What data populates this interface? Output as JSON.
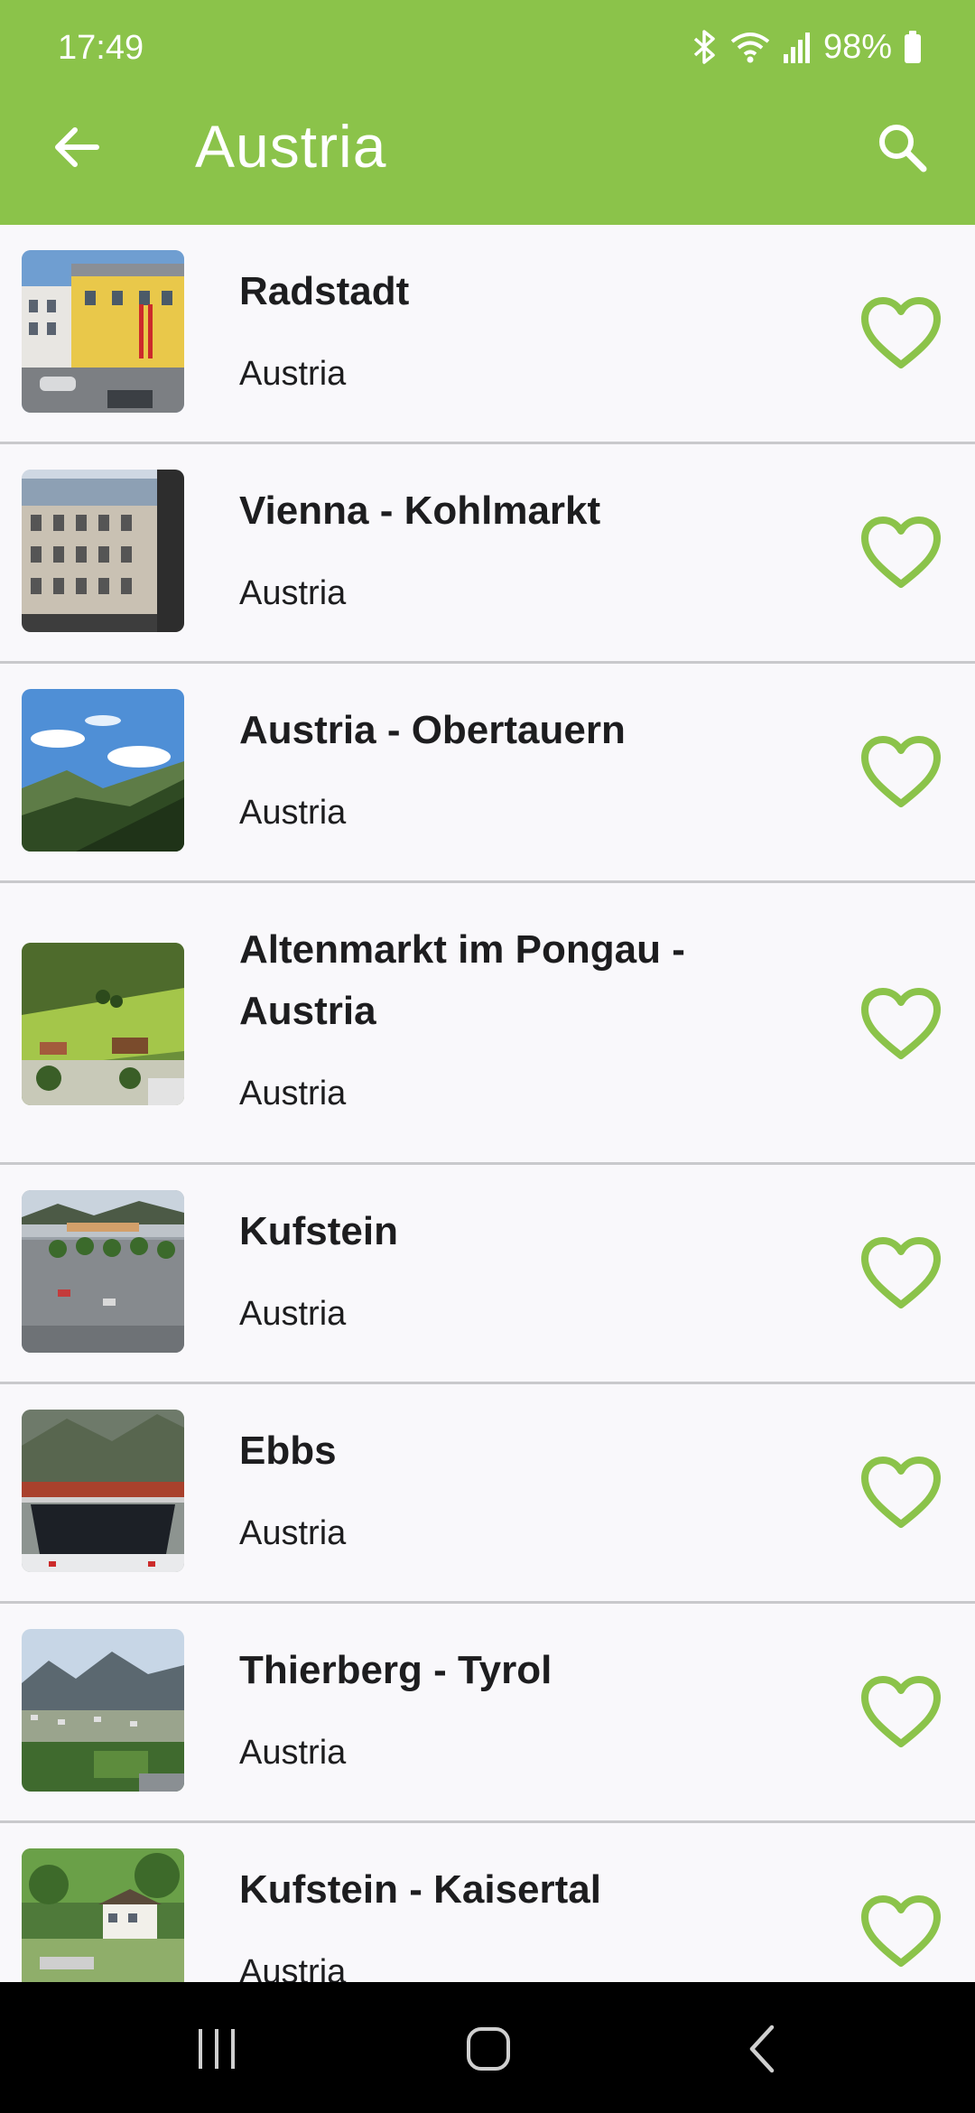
{
  "status_bar": {
    "time": "17:49",
    "battery": "98%",
    "icons": [
      "bluetooth-icon",
      "wifi-icon",
      "signal-icon",
      "battery-icon"
    ]
  },
  "app_bar": {
    "title": "Austria",
    "back_icon": "arrow-left-icon",
    "search_icon": "search-icon",
    "background_color": "#8bc34a"
  },
  "accent_color": "#8bc34a",
  "webcams": [
    {
      "title": "Radstadt",
      "country": "Austria",
      "favorite": false
    },
    {
      "title": "Vienna - Kohlmarkt",
      "country": "Austria",
      "favorite": false
    },
    {
      "title": "Austria - Obertauern",
      "country": "Austria",
      "favorite": false
    },
    {
      "title": "Altenmarkt im Pongau - Austria",
      "country": "Austria",
      "favorite": false
    },
    {
      "title": "Kufstein",
      "country": "Austria",
      "favorite": false
    },
    {
      "title": "Ebbs",
      "country": "Austria",
      "favorite": false
    },
    {
      "title": "Thierberg - Tyrol",
      "country": "Austria",
      "favorite": false
    },
    {
      "title": "Kufstein - Kaisertal",
      "country": "Austria",
      "favorite": false
    }
  ],
  "nav_bar": {
    "buttons": [
      "recent-apps-icon",
      "home-icon",
      "back-icon"
    ]
  }
}
